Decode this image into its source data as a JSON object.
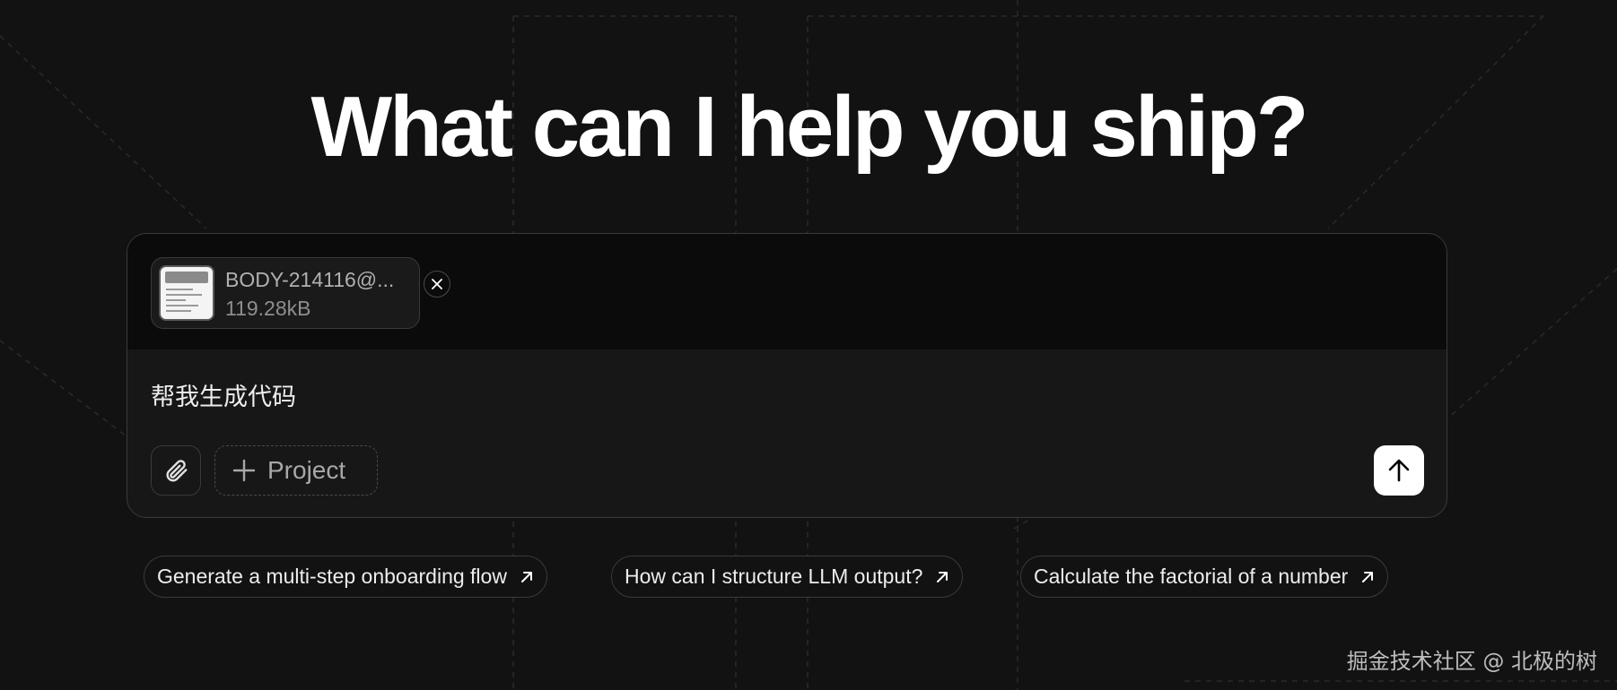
{
  "hero": {
    "title": "What can I help you ship?"
  },
  "composer": {
    "attachment": {
      "name": "BODY-214116@...",
      "size": "119.28kB"
    },
    "prompt": "帮我生成代码",
    "project_label": "Project"
  },
  "suggestions": [
    {
      "label": "Generate a multi-step onboarding flow"
    },
    {
      "label": "How can I structure LLM output?"
    },
    {
      "label": "Calculate the factorial of a number"
    }
  ],
  "watermark": "掘金技术社区 @ 北极的树",
  "icons": {
    "attach": "paperclip-icon",
    "project": "plus-icon",
    "send": "arrow-up-icon",
    "remove": "close-icon",
    "suggestion": "arrow-up-right-icon"
  },
  "colors": {
    "background": "#121212",
    "composer": "#171717",
    "accent": "#ffffff"
  }
}
